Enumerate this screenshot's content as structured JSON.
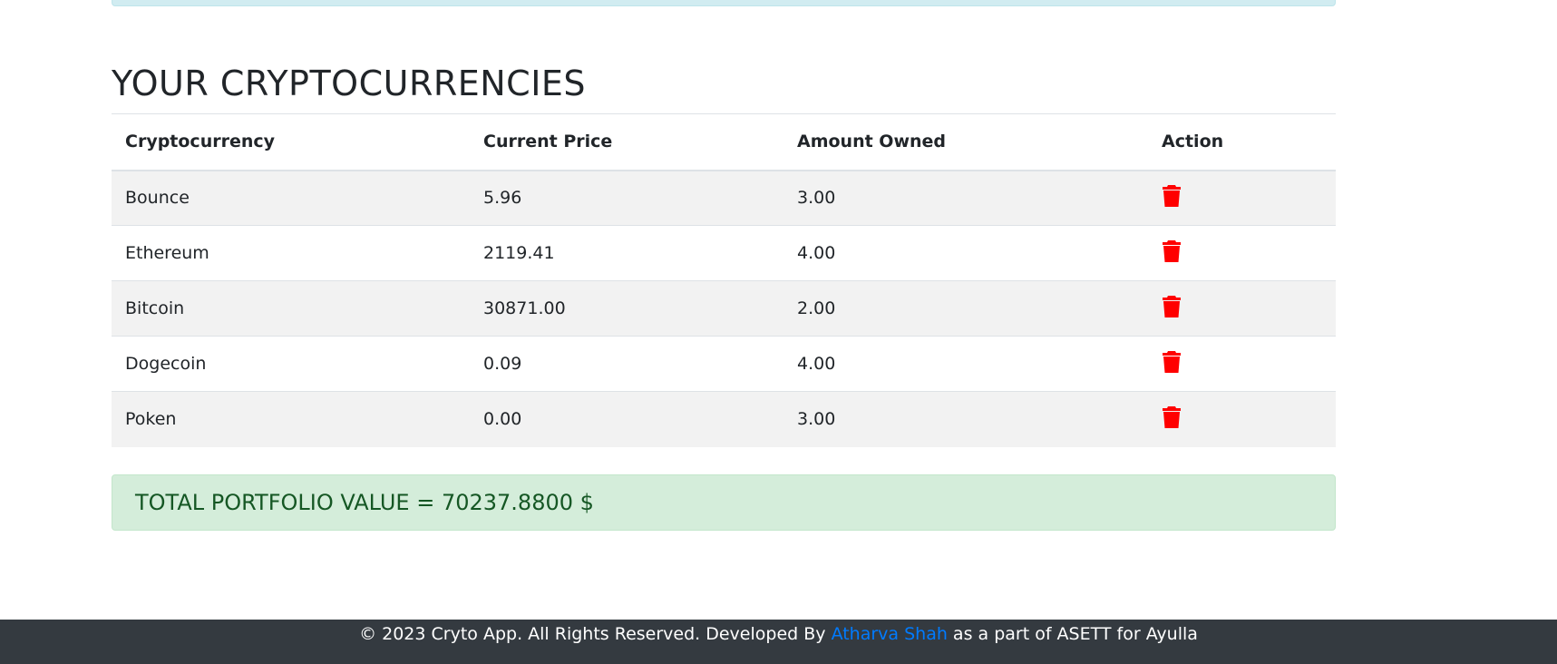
{
  "section": {
    "title": "YOUR CRYPTOCURRENCIES"
  },
  "table": {
    "headers": [
      "Cryptocurrency",
      "Current Price",
      "Amount Owned",
      "Action"
    ],
    "rows": [
      {
        "name": "Bounce",
        "price": "5.96",
        "amount": "3.00"
      },
      {
        "name": "Ethereum",
        "price": "2119.41",
        "amount": "4.00"
      },
      {
        "name": "Bitcoin",
        "price": "30871.00",
        "amount": "2.00"
      },
      {
        "name": "Dogecoin",
        "price": "0.09",
        "amount": "4.00"
      },
      {
        "name": "Poken",
        "price": "0.00",
        "amount": "3.00"
      }
    ],
    "action_icon": "trash-icon"
  },
  "total": {
    "label": "TOTAL PORTFOLIO VALUE = 70237.8800 $"
  },
  "footer": {
    "prefix": "© 2023 Cryto App. All Rights Reserved. Developed By ",
    "author": "Atharva Shah",
    "suffix": " as a part of ASETT for Ayulla"
  },
  "colors": {
    "danger": "#ff0000",
    "link": "#007bff",
    "success_bg": "#d4edda",
    "success_text": "#155724",
    "footer_bg": "#343a40",
    "info_bg": "#d1ecf1"
  }
}
